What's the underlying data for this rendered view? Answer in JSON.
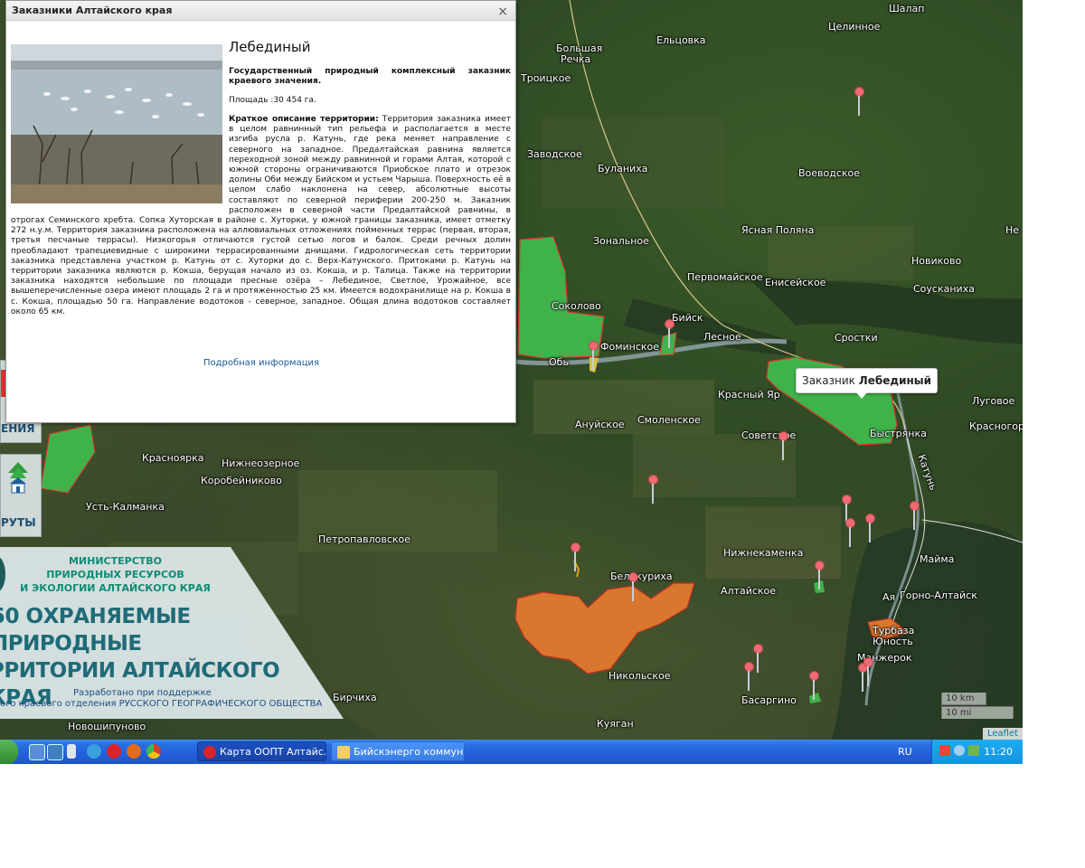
{
  "map": {
    "places": [
      {
        "name": "Шалап"
      },
      {
        "name": "Целинное"
      },
      {
        "name": "Большая"
      },
      {
        "name": "Речка"
      },
      {
        "name": "Ельцовка"
      },
      {
        "name": "Троицкое"
      },
      {
        "name": "Заводское"
      },
      {
        "name": "Буланиха"
      },
      {
        "name": "Воеводское"
      },
      {
        "name": "Зональное"
      },
      {
        "name": "Ясная Поляна"
      },
      {
        "name": "Не"
      },
      {
        "name": "Первомайское"
      },
      {
        "name": "Новиково"
      },
      {
        "name": "Енисейское"
      },
      {
        "name": "Соусканиха"
      },
      {
        "name": "Соколово"
      },
      {
        "name": "Бийск"
      },
      {
        "name": "Лесное"
      },
      {
        "name": "Фоминское"
      },
      {
        "name": "Обь"
      },
      {
        "name": "Сростки"
      },
      {
        "name": "Красный Яр"
      },
      {
        "name": "Луговое"
      },
      {
        "name": "Ануйское"
      },
      {
        "name": "Смоленское"
      },
      {
        "name": "Советское"
      },
      {
        "name": "Быстрянка"
      },
      {
        "name": "Красногор"
      },
      {
        "name": "Красноярка"
      },
      {
        "name": "Нижнеозерное"
      },
      {
        "name": "Коробейниково"
      },
      {
        "name": "Усть-Калманка"
      },
      {
        "name": "Катунь"
      },
      {
        "name": "Петропавловское"
      },
      {
        "name": "Нижнекаменка"
      },
      {
        "name": "Майма"
      },
      {
        "name": "Белокуриха"
      },
      {
        "name": "Алтайское"
      },
      {
        "name": "Горно-Алтайск"
      },
      {
        "name": "Ая"
      },
      {
        "name": "Турбаза"
      },
      {
        "name": "Юность"
      },
      {
        "name": "Манжерок"
      },
      {
        "name": "Никольское"
      },
      {
        "name": "Басаргино"
      },
      {
        "name": "Бирчиха"
      },
      {
        "name": "Новошипуново"
      },
      {
        "name": "Куяган"
      }
    ],
    "tooltip": {
      "prefix": "Заказник",
      "name": "Лебединый"
    },
    "scale": {
      "km": "10 km",
      "mi": "10 mi"
    },
    "attribution": "Leaflet",
    "colors": {
      "green_zone": "#3fb34a",
      "orange_zone": "#d9772e",
      "pin": "#ef6b73"
    }
  },
  "side": {
    "label_top": "ЕНИЯ",
    "label_routes": "РУТЫ",
    "banner": {
      "ministry": "МИНИСТЕРСТВО\nПРИРОДНЫХ РЕСУРСОВ\nИ ЭКОЛОГИИ АЛТАЙСКОГО КРАЯ",
      "big_line1": "50 ОХРАНЯЕМЫЕ ПРИРОДНЫЕ",
      "big_line2": "РРИТОРИИ АЛТАЙСКОГО КРАЯ",
      "support_line1": "Разработано при поддержке",
      "support_line2": "ого краевого отделения РУССКОГО ГЕОГРАФИЧЕСКОГО ОБЩЕСТВА"
    }
  },
  "popup": {
    "window_title": "Заказники Алтайского края",
    "close_label": "×",
    "name": "Лебединый",
    "status": "Государственный природный комплексный заказник краевого значения.",
    "area": "Площадь :30 454 га.",
    "desc_label": "Краткое описание территории:",
    "desc_text": " Территория заказника имеет в целом равнинный тип рельефа и располагается в месте изгиба русла р. Катунь, где река меняет направление с северного на западное. Предалтайская равнина является переходной зоной между равнинной и горами Алтая, которой с южной стороны ограничиваются Приобское плато и отрезок долины Оби между Бийском и устьем Чарыша. Поверхность её в целом слабо наклонена на север, абсолютные высоты составляют по северной периферии 200-250 м. Заказник расположен в северной части Предалтайской равнины, в отрогах Семинского хребта. Сопка Хуторская в районе с. Хуторки, у южной границы заказника, имеет отметку 272 н.у.м. Территория заказника расположена на аллювиальных отложениях пойменных террас (первая, вторая, третья песчаные террасы). Низкогорья отличаются густой сетью логов и балок. Среди речных долин преобладают трапециевидные с широкими террасированными днищами. Гидрологическая сеть территории заказника представлена участком р. Катунь от с. Хуторки до с. Верх-Катунского. Притоками р. Катунь на территории заказника являются р. Кокша, берущая начало из оз. Кокша, и р. Талица. Также на территории заказника находятся небольшие по площади пресные озёра – Лебединое, Светлое, Урожайное, все вышеперечисленные озера имеют площадь 2 га и протяженностью 25 км. Имеется водохранилище на р. Кокша в с. Кокша, площадью 50 га. Направление водотоков - северное, западное. Общая длина водотоков составляет около 65 км.",
    "link": "Подробная информация"
  },
  "taskbar": {
    "tasks": [
      {
        "label": "Карта ООПТ Алтайс..."
      },
      {
        "label": "Бийскэнерго коммун..."
      }
    ],
    "lang": "RU",
    "clock": "11:20"
  }
}
